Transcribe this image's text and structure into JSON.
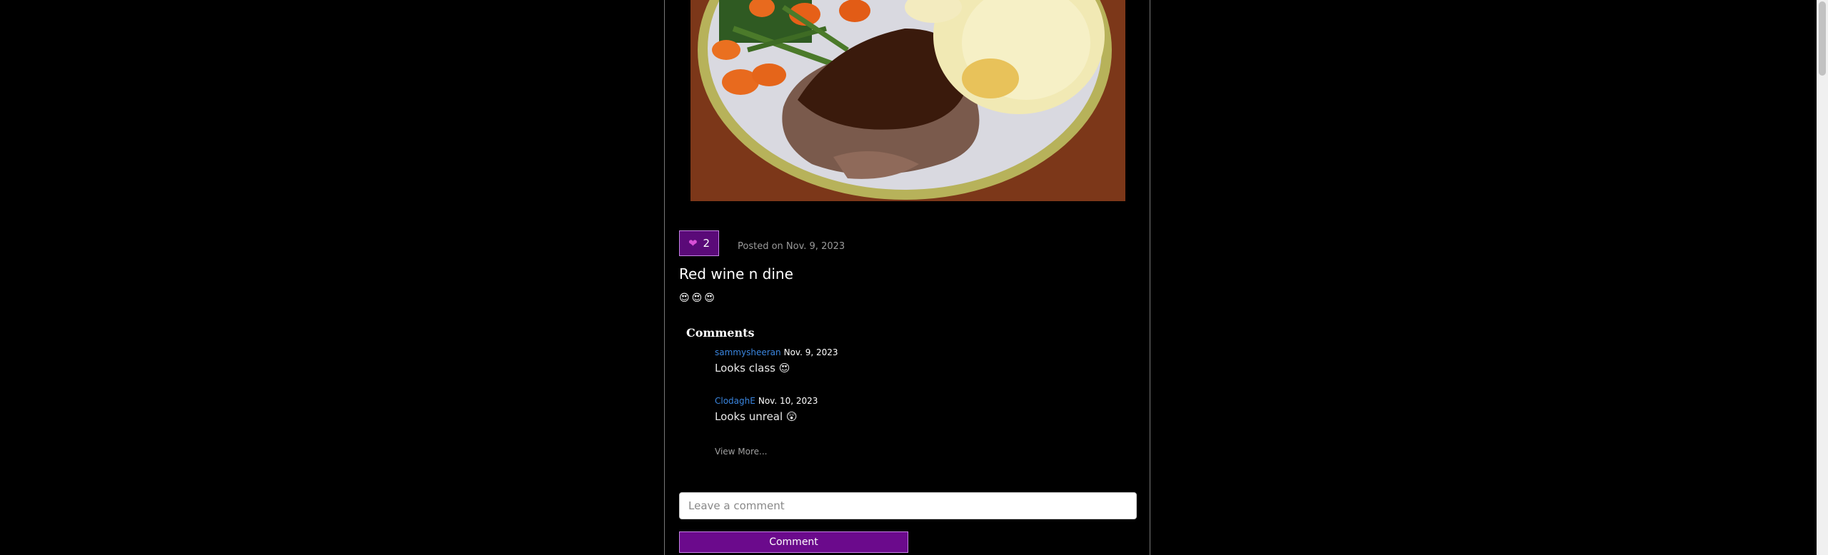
{
  "post": {
    "like_count": "2",
    "posted_on": "Posted on Nov. 9, 2023",
    "title": "Red wine n dine",
    "body": "😍😍😍",
    "image_alt": "Plate of roast beef with gravy, carrots, green beans and scalloped potatoes"
  },
  "comments": {
    "heading": "Comments",
    "items": [
      {
        "author": "sammysheeran",
        "date": "Nov. 9, 2023",
        "text": "Looks class 😍"
      },
      {
        "author": "ClodaghE",
        "date": "Nov. 10, 2023",
        "text": "Looks unreal 😲"
      }
    ],
    "view_more": "View More..."
  },
  "comment_form": {
    "placeholder": "Leave a comment",
    "button_label": "Comment"
  },
  "icons": {
    "like": "heart-icon"
  },
  "colors": {
    "accent": "#6b0a8c",
    "link": "#3a86e0",
    "background": "#000000"
  }
}
